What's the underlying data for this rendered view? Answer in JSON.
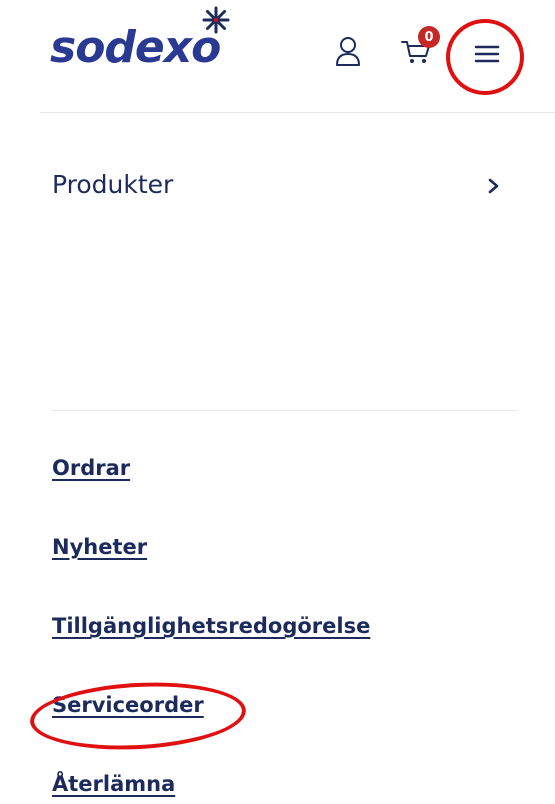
{
  "header": {
    "logo_text": "sodexo",
    "cart_count": "0",
    "icons": {
      "account": "user-icon",
      "cart": "cart-icon",
      "menu": "hamburger-menu-icon",
      "logo_star": "star-icon"
    }
  },
  "menu": {
    "products_label": "Produkter",
    "products_chevron": "chevron-right-icon",
    "links": [
      {
        "label": "Ordrar"
      },
      {
        "label": "Nyheter"
      },
      {
        "label": "Tillgänglighetsredogörelse"
      },
      {
        "label": "Serviceorder"
      },
      {
        "label": "Återlämna"
      }
    ]
  },
  "colors": {
    "brand": "#2a3a92",
    "text": "#1d2a5c",
    "badge": "#c62828",
    "annotation": "#e01010"
  }
}
